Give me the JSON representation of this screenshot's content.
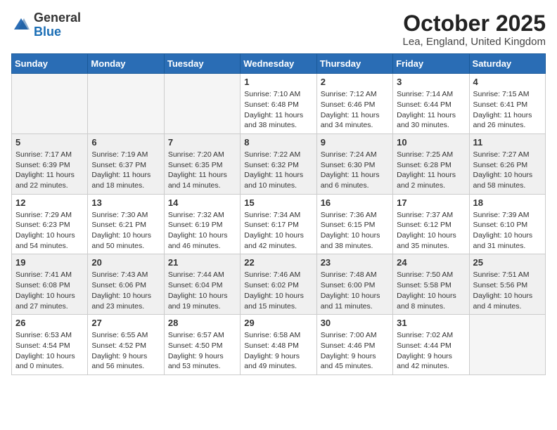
{
  "header": {
    "logo": {
      "general": "General",
      "blue": "Blue"
    },
    "month": "October 2025",
    "location": "Lea, England, United Kingdom"
  },
  "weekdays": [
    "Sunday",
    "Monday",
    "Tuesday",
    "Wednesday",
    "Thursday",
    "Friday",
    "Saturday"
  ],
  "weeks": [
    [
      {
        "day": "",
        "info": ""
      },
      {
        "day": "",
        "info": ""
      },
      {
        "day": "",
        "info": ""
      },
      {
        "day": "1",
        "info": "Sunrise: 7:10 AM\nSunset: 6:48 PM\nDaylight: 11 hours\nand 38 minutes."
      },
      {
        "day": "2",
        "info": "Sunrise: 7:12 AM\nSunset: 6:46 PM\nDaylight: 11 hours\nand 34 minutes."
      },
      {
        "day": "3",
        "info": "Sunrise: 7:14 AM\nSunset: 6:44 PM\nDaylight: 11 hours\nand 30 minutes."
      },
      {
        "day": "4",
        "info": "Sunrise: 7:15 AM\nSunset: 6:41 PM\nDaylight: 11 hours\nand 26 minutes."
      }
    ],
    [
      {
        "day": "5",
        "info": "Sunrise: 7:17 AM\nSunset: 6:39 PM\nDaylight: 11 hours\nand 22 minutes."
      },
      {
        "day": "6",
        "info": "Sunrise: 7:19 AM\nSunset: 6:37 PM\nDaylight: 11 hours\nand 18 minutes."
      },
      {
        "day": "7",
        "info": "Sunrise: 7:20 AM\nSunset: 6:35 PM\nDaylight: 11 hours\nand 14 minutes."
      },
      {
        "day": "8",
        "info": "Sunrise: 7:22 AM\nSunset: 6:32 PM\nDaylight: 11 hours\nand 10 minutes."
      },
      {
        "day": "9",
        "info": "Sunrise: 7:24 AM\nSunset: 6:30 PM\nDaylight: 11 hours\nand 6 minutes."
      },
      {
        "day": "10",
        "info": "Sunrise: 7:25 AM\nSunset: 6:28 PM\nDaylight: 11 hours\nand 2 minutes."
      },
      {
        "day": "11",
        "info": "Sunrise: 7:27 AM\nSunset: 6:26 PM\nDaylight: 10 hours\nand 58 minutes."
      }
    ],
    [
      {
        "day": "12",
        "info": "Sunrise: 7:29 AM\nSunset: 6:23 PM\nDaylight: 10 hours\nand 54 minutes."
      },
      {
        "day": "13",
        "info": "Sunrise: 7:30 AM\nSunset: 6:21 PM\nDaylight: 10 hours\nand 50 minutes."
      },
      {
        "day": "14",
        "info": "Sunrise: 7:32 AM\nSunset: 6:19 PM\nDaylight: 10 hours\nand 46 minutes."
      },
      {
        "day": "15",
        "info": "Sunrise: 7:34 AM\nSunset: 6:17 PM\nDaylight: 10 hours\nand 42 minutes."
      },
      {
        "day": "16",
        "info": "Sunrise: 7:36 AM\nSunset: 6:15 PM\nDaylight: 10 hours\nand 38 minutes."
      },
      {
        "day": "17",
        "info": "Sunrise: 7:37 AM\nSunset: 6:12 PM\nDaylight: 10 hours\nand 35 minutes."
      },
      {
        "day": "18",
        "info": "Sunrise: 7:39 AM\nSunset: 6:10 PM\nDaylight: 10 hours\nand 31 minutes."
      }
    ],
    [
      {
        "day": "19",
        "info": "Sunrise: 7:41 AM\nSunset: 6:08 PM\nDaylight: 10 hours\nand 27 minutes."
      },
      {
        "day": "20",
        "info": "Sunrise: 7:43 AM\nSunset: 6:06 PM\nDaylight: 10 hours\nand 23 minutes."
      },
      {
        "day": "21",
        "info": "Sunrise: 7:44 AM\nSunset: 6:04 PM\nDaylight: 10 hours\nand 19 minutes."
      },
      {
        "day": "22",
        "info": "Sunrise: 7:46 AM\nSunset: 6:02 PM\nDaylight: 10 hours\nand 15 minutes."
      },
      {
        "day": "23",
        "info": "Sunrise: 7:48 AM\nSunset: 6:00 PM\nDaylight: 10 hours\nand 11 minutes."
      },
      {
        "day": "24",
        "info": "Sunrise: 7:50 AM\nSunset: 5:58 PM\nDaylight: 10 hours\nand 8 minutes."
      },
      {
        "day": "25",
        "info": "Sunrise: 7:51 AM\nSunset: 5:56 PM\nDaylight: 10 hours\nand 4 minutes."
      }
    ],
    [
      {
        "day": "26",
        "info": "Sunrise: 6:53 AM\nSunset: 4:54 PM\nDaylight: 10 hours\nand 0 minutes."
      },
      {
        "day": "27",
        "info": "Sunrise: 6:55 AM\nSunset: 4:52 PM\nDaylight: 9 hours\nand 56 minutes."
      },
      {
        "day": "28",
        "info": "Sunrise: 6:57 AM\nSunset: 4:50 PM\nDaylight: 9 hours\nand 53 minutes."
      },
      {
        "day": "29",
        "info": "Sunrise: 6:58 AM\nSunset: 4:48 PM\nDaylight: 9 hours\nand 49 minutes."
      },
      {
        "day": "30",
        "info": "Sunrise: 7:00 AM\nSunset: 4:46 PM\nDaylight: 9 hours\nand 45 minutes."
      },
      {
        "day": "31",
        "info": "Sunrise: 7:02 AM\nSunset: 4:44 PM\nDaylight: 9 hours\nand 42 minutes."
      },
      {
        "day": "",
        "info": ""
      }
    ]
  ]
}
